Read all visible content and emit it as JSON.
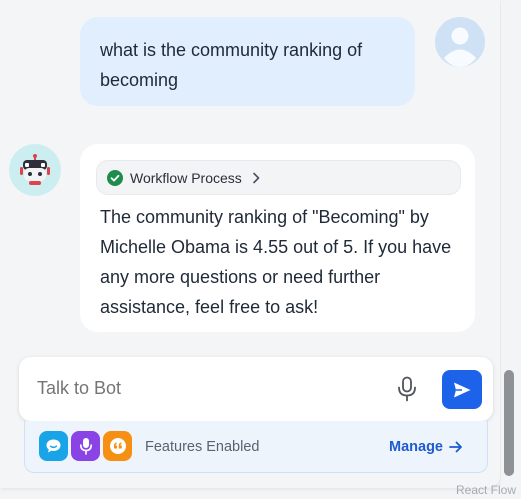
{
  "conversation": {
    "user_message": "what is the community ranking of becoming",
    "bot_chip_label": "Workflow Process",
    "bot_message": "The community ranking of \"Becoming\" by Michelle Obama is 4.55 out of 5. If you have any more questions or need further assistance, feel free to ask!"
  },
  "composer": {
    "placeholder": "Talk to Bot"
  },
  "features": {
    "label": "Features Enabled",
    "manage_label": "Manage",
    "icons": [
      "chat-icon",
      "microphone-icon",
      "quote-icon"
    ]
  },
  "footer": {
    "watermark": "React Flow"
  },
  "colors": {
    "accent": "#1d63ea",
    "user_bubble": "#e1eefd",
    "chat_feature": "#1aa4e8",
    "voice_feature": "#8a44e6",
    "quote_feature": "#f59015",
    "success": "#1f8b4c"
  }
}
